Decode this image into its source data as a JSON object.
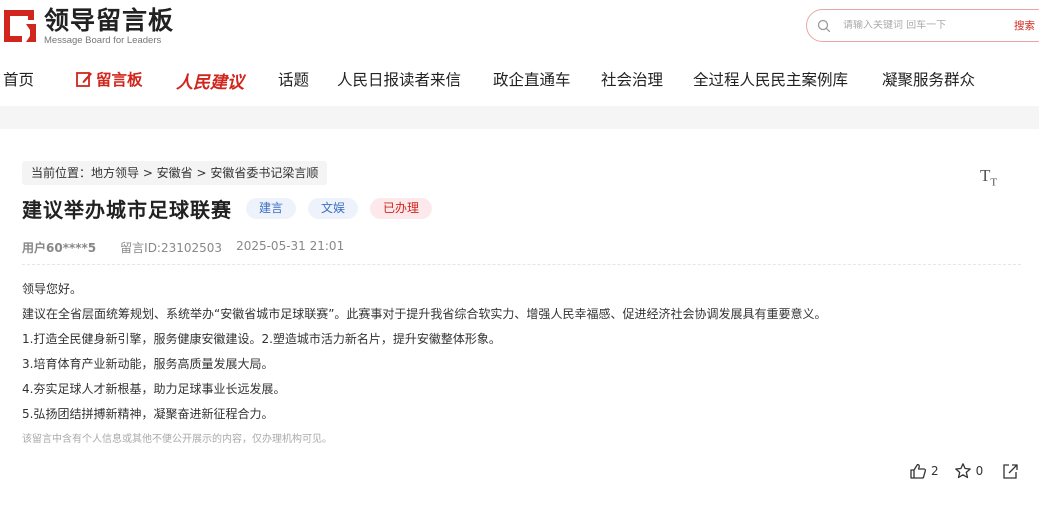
{
  "brand": {
    "title": "领导留言板",
    "subtitle": "Message Board for Leaders",
    "accent": "#d0261d"
  },
  "search": {
    "placeholder": "请输入关键词 回车一下",
    "button": "搜索"
  },
  "nav": {
    "items": [
      {
        "label": "首页"
      },
      {
        "label": "留言板",
        "active": true,
        "icon": "note-edit-icon"
      },
      {
        "label": "人民建议",
        "icon": "renmin-logo"
      },
      {
        "label": "话题"
      },
      {
        "label": "人民日报读者来信"
      },
      {
        "label": "政企直通车"
      },
      {
        "label": "社会治理"
      },
      {
        "label": "全过程人民民主案例库"
      },
      {
        "label": "凝聚服务群众"
      }
    ]
  },
  "breadcrumb": "当前位置：地方领导 > 安徽省 > 安徽省委书记梁言顺",
  "font_size_toggle": "TT",
  "message": {
    "title": "建议举办城市足球联赛",
    "tags": {
      "type": "建言",
      "category": "文娱",
      "status": "已办理"
    },
    "user": "用户60****5",
    "message_id": "留言ID:23102503",
    "datetime": "2025-05-31 21:01",
    "paragraphs": [
      "领导您好。",
      "建议在全省层面统筹规划、系统举办“安徽省城市足球联赛”。此赛事对于提升我省综合软实力、增强人民幸福感、促进经济社会协调发展具有重要意义。",
      "1.打造全民健身新引擎，服务健康安徽建设。2.塑造城市活力新名片，提升安徽整体形象。",
      "3.培育体育产业新动能，服务高质量发展大局。",
      "4.夯实足球人才新根基，助力足球事业长远发展。",
      "5.弘扬团结拼搏新精神，凝聚奋进新征程合力。"
    ],
    "disclaimer": "该留言中含有个人信息或其他不便公开展示的内容，仅办理机构可见。"
  },
  "actions": {
    "likes": "2",
    "favorites": "0",
    "icons": [
      "thumbs-up-icon",
      "star-icon",
      "share-icon"
    ]
  }
}
